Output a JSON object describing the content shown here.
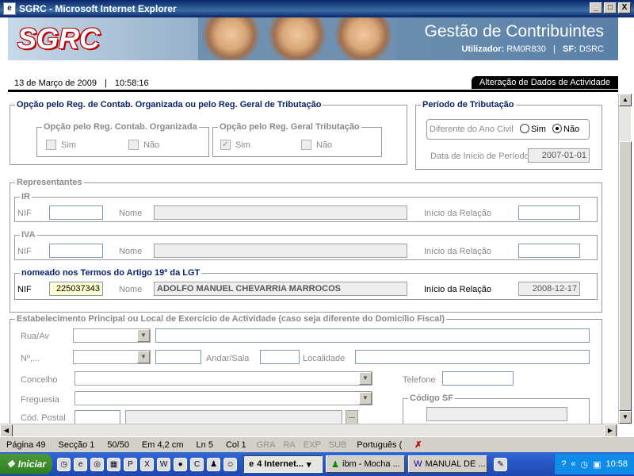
{
  "window": {
    "title": "SGRC - Microsoft Internet Explorer",
    "min": "_",
    "max": "□",
    "close": "X"
  },
  "banner": {
    "logo": "SGRC",
    "title": "Gestão de Contribuintes",
    "user_label": "Utilizador:",
    "user_value": "RM0R830",
    "sf_label": "SF:",
    "sf_value": "DSRC"
  },
  "header": {
    "date": "13 de Março de 2009",
    "sep": "|",
    "time": "10:58:16",
    "action": "Alteração de Dados de Actividade"
  },
  "opcao": {
    "legend": "Opção pelo Reg. de Contab. Organizada ou pelo Reg. Geral de Tributação",
    "contab": {
      "legend": "Opção pelo Reg. Contab. Organizada",
      "sim": "Sim",
      "nao": "Não"
    },
    "geral": {
      "legend": "Opção pelo Reg. Geral Tributação",
      "sim": "Sim",
      "nao": "Não"
    }
  },
  "periodo": {
    "legend": "Período de Tributação",
    "diferente_label": "Diferente do Ano Civil",
    "sim": "Sim",
    "nao": "Não",
    "inicio_label": "Data de Início de Período",
    "inicio_value": "2007-01-01"
  },
  "representantes": {
    "legend": "Representantes",
    "ir": {
      "legend": "IR",
      "nif": "NIF",
      "nome": "Nome",
      "inicio": "Início da Relação"
    },
    "iva": {
      "legend": "IVA",
      "nif": "NIF",
      "nome": "Nome",
      "inicio": "Início da Relação"
    },
    "lgt": {
      "legend": "nomeado nos Termos do Artigo 19º da LGT",
      "nif": "NIF",
      "nif_value": "225037343",
      "nome": "Nome",
      "nome_value": "ADOLFO MANUEL CHEVARRIA MARROCOS",
      "inicio": "Início da Relação",
      "inicio_value": "2008-12-17"
    }
  },
  "estab": {
    "legend": "Estabelecimento Principal ou Local de Exercício de Actividade (caso seja diferente do Domicílio Fiscal)",
    "rua": "Rua/Av",
    "numero": "Nº,...",
    "andar": "Andar/Sala",
    "localidade": "Localidade",
    "concelho": "Concelho",
    "telefone": "Telefone",
    "freguesia": "Freguesia",
    "codigo_sf": "Código SF",
    "cod_postal": "Cód. Postal",
    "lookup": "..."
  },
  "statusbar": {
    "pagina": "Página 49",
    "seccao": "Secção 1",
    "pages": "50/50",
    "em": "Em 4,2 cm",
    "ln": "Ln 5",
    "col": "Col 1",
    "gra": "GRA",
    "ra": "RA",
    "exp": "EXP",
    "sub": "SUB",
    "lang": "Português ("
  },
  "taskbar": {
    "start": "Iniciar",
    "tasks": [
      "4 Internet...",
      "ibm - Mocha ...",
      "MANUAL DE ..."
    ],
    "clock": "10:58"
  }
}
